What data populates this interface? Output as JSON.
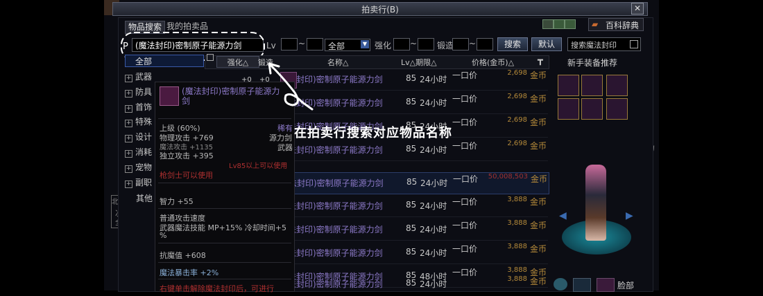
{
  "window": {
    "title": "拍卖行(B)",
    "close_label": "✕"
  },
  "tabs": {
    "item_search": "物品搜索",
    "my_auction": "我的拍卖品"
  },
  "toolbar": {
    "encyclopedia": "百科辞典",
    "search_input_value": "(魔法封印)密制原子能源力剑",
    "lv_label": "Lv",
    "tilde": "~",
    "grade_value": "全部",
    "enhance_label": "强化",
    "forge_label": "锻造",
    "search_button": "搜索",
    "default_button": "默认",
    "magic_seal_search": "搜索魔法封印"
  },
  "categories": {
    "all": "全部",
    "items": [
      "武器",
      "防具",
      "首饰",
      "特殊",
      "设计",
      "消耗",
      "宠物",
      "副职"
    ],
    "other": "其他"
  },
  "columns": {
    "enhance": "强化△",
    "forge": "锻造",
    "name": "名称△",
    "lv_period": "Lv△期限△",
    "price": "价格(金币)△"
  },
  "rows": [
    {
      "name": "法封印)密制原子能源力剑",
      "lv": "85",
      "dur": "24小时",
      "once": "一口价",
      "price": "2,698",
      "unit": "金币",
      "enh": "+0",
      "forge": "+0"
    },
    {
      "name": "法封印)密制原子能源力剑",
      "lv": "85",
      "dur": "24小时",
      "once": "一口价",
      "price": "2,698",
      "unit": "金币"
    },
    {
      "name": "法封印)密制原子能源力剑",
      "lv": "85",
      "dur": "24小时",
      "once": "一口价",
      "price": "2,698",
      "unit": "金币"
    },
    {
      "name": "法封印)密制原子能源力剑",
      "lv": "85",
      "dur": "24小时",
      "once": "一口价",
      "price": "2,698",
      "unit": "金币"
    },
    {
      "name": "法封印)密制原子能源力剑",
      "lv": "85",
      "dur": "24小时",
      "once": "一口价",
      "price": "50,008,503",
      "unit": "金币"
    },
    {
      "name": "法封印)密制原子能源力剑",
      "lv": "85",
      "dur": "24小时",
      "once": "一口价",
      "price": "3,888",
      "unit": "金币"
    },
    {
      "name": "法封印)密制原子能源力剑",
      "lv": "85",
      "dur": "24小时",
      "once": "一口价",
      "price": "3,888",
      "unit": "金币"
    },
    {
      "name": "法封印)密制原子能源力剑",
      "lv": "85",
      "dur": "24小时",
      "once": "一口价",
      "price": "3,888",
      "unit": "金币"
    },
    {
      "name": "法封印)密制原子能源力剑",
      "lv": "85",
      "dur": "48小时",
      "once": "一口价",
      "price": "3,888",
      "unit": "金币"
    },
    {
      "name": "法封印)密制原子能源力剑",
      "lv": "85",
      "dur": "24小时",
      "once": "一口价",
      "price": "3,888",
      "unit": "金币"
    }
  ],
  "tooltip": {
    "title": "(魔法封印)密制原子能源力剑",
    "grade": "上级 (60%)",
    "rarity": "稀有",
    "type1": "源力剑",
    "type2": "武器",
    "phys_atk": "物理攻击 +769",
    "mag_atk": "魔法攻击 +1135",
    "indep_atk": "独立攻击 +395",
    "lv_req": "Lv85以上可以使用",
    "class_req": "枪剑士可以使用",
    "int": "智力 +55",
    "atk_speed": "普通攻击速度",
    "skill_line": "武器魔法技能  MP+15% 冷却时间+5",
    "percent": "%",
    "magic_res": "抗魔值 +608",
    "magic_crit": "魔法暴击率 +2%",
    "bottom": "右键单击解除魔法封印后，可进行"
  },
  "right_panel": {
    "title": "新手装备推荐",
    "face": "脸部"
  },
  "side_fragments": {
    "left1": "北",
    "left2": "次=",
    "left3": "全游",
    "right1": "场"
  },
  "annotation": {
    "text": "在拍卖行搜索对应物品名称",
    "letter": "P"
  }
}
